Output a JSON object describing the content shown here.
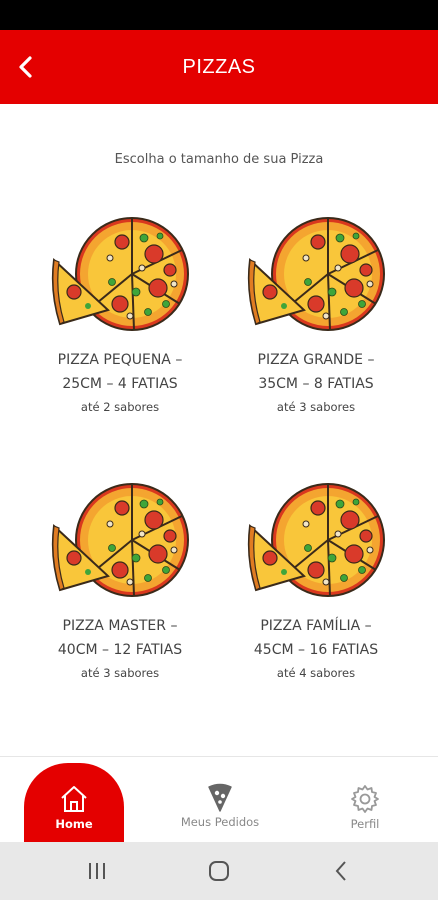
{
  "app_bar": {
    "title": "PIZZAS",
    "back_icon": "chevron-left-icon",
    "color": "#e40000"
  },
  "subtitle": "Escolha o tamanho de sua Pizza",
  "sizes": [
    {
      "name_line1": "PIZZA PEQUENA –",
      "name_line2": "25CM – 4 FATIAS",
      "flavors": "até 2 sabores"
    },
    {
      "name_line1": "PIZZA GRANDE –",
      "name_line2": "35CM – 8 FATIAS",
      "flavors": "até 3 sabores"
    },
    {
      "name_line1": "PIZZA MASTER –",
      "name_line2": "40CM – 12 FATIAS",
      "flavors": "até 3 sabores"
    },
    {
      "name_line1": "PIZZA FAMÍLIA –",
      "name_line2": "45CM – 16 FATIAS",
      "flavors": "até 4 sabores"
    }
  ],
  "bottom_nav": {
    "items": [
      {
        "label": "Home",
        "icon": "home-icon",
        "active": true
      },
      {
        "label": "Meus Pedidos",
        "icon": "pizza-slice-icon",
        "active": false
      },
      {
        "label": "Perfil",
        "icon": "gear-icon",
        "active": false
      }
    ]
  },
  "system_nav": [
    "recent-apps-icon",
    "home-circle-icon",
    "back-icon"
  ]
}
